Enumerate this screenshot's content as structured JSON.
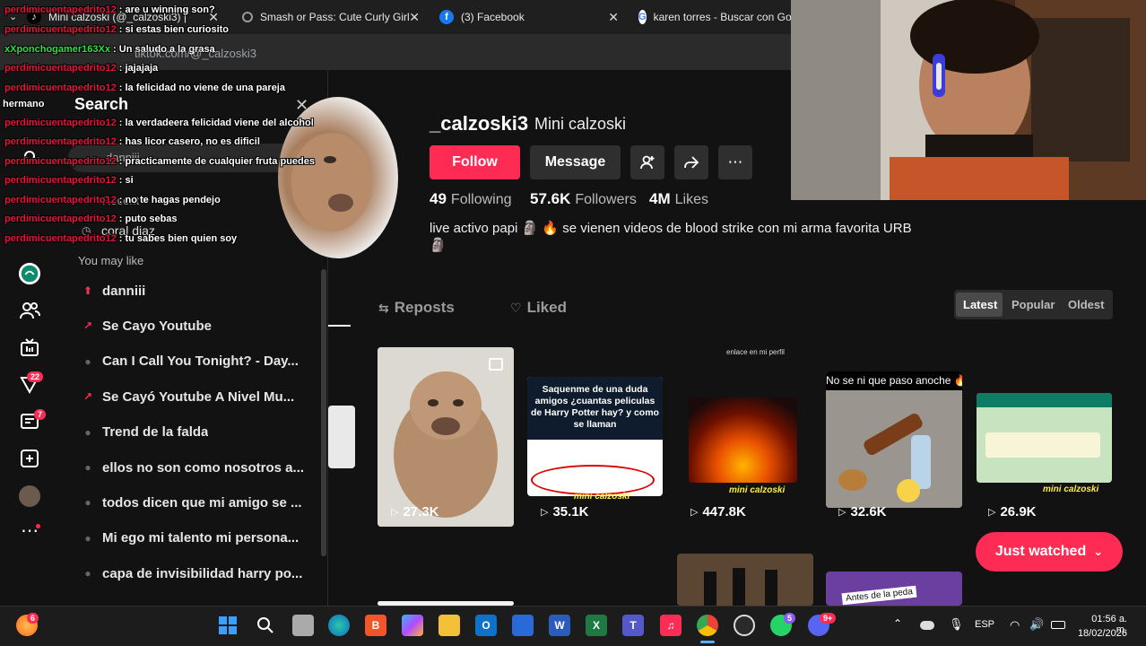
{
  "browser": {
    "tabs": [
      {
        "title": "Mini calzoski (@_calzoski3) | "
      },
      {
        "title": "Smash or Pass: Cute Curly Girl -"
      },
      {
        "title": "(3) Facebook"
      },
      {
        "title": "karen torres - Buscar con Goo"
      }
    ],
    "url": "tiktok.com/@_calzoski3"
  },
  "search_panel": {
    "title": "Search",
    "query": "danniii",
    "recent_label": "Recent",
    "recent_item": "coral diaz",
    "you_may_like": "You may like",
    "suggestions": [
      {
        "label": "danniii",
        "icon": "arrow-up-icon"
      },
      {
        "label": "Se Cayo Youtube",
        "icon": "trending-icon"
      },
      {
        "label": "Can I Call You Tonight? - Day...",
        "icon": "dot-icon"
      },
      {
        "label": "Se Cayó Youtube A Nivel Mu...",
        "icon": "trending-icon"
      },
      {
        "label": "Trend de la falda",
        "icon": "dot-icon"
      },
      {
        "label": "ellos no son como nosotros a...",
        "icon": "dot-icon"
      },
      {
        "label": "todos dicen que mi amigo se ...",
        "icon": "dot-icon"
      },
      {
        "label": "Mi ego mi talento mi persona...",
        "icon": "dot-icon"
      },
      {
        "label": "capa de invisibilidad harry po...",
        "icon": "dot-icon"
      }
    ]
  },
  "left_nav": {
    "inbox_badge": "22",
    "messages_badge": "7"
  },
  "profile": {
    "username": "_calzoski3",
    "nickname": "Mini calzoski",
    "follow_label": "Follow",
    "message_label": "Message",
    "following_count": "49",
    "following_label": "Following",
    "followers_count": "57.6K",
    "followers_label": "Followers",
    "likes_count": "4M",
    "likes_label": "Likes",
    "bio_line1": "live activo papi 🗿 🔥 se vienen videos de blood strike con mi arma favorita URB",
    "bio_line2": "🗿"
  },
  "tabs": {
    "reposts": "Reposts",
    "liked": "Liked",
    "sort_latest": "Latest",
    "sort_popular": "Popular",
    "sort_oldest": "Oldest"
  },
  "videos": [
    {
      "views": "27.3K"
    },
    {
      "views": "35.1K",
      "title": "Saquenme de una duda amigos ¿cuantas peliculas de Harry Potter hay? y como se llaman",
      "watermark": "mini calzoski"
    },
    {
      "views": "447.8K",
      "watermark": "mini calzoski",
      "caption": "enlace en mi perfil"
    },
    {
      "views": "32.6K",
      "title": "No se ni que paso anoche 🔥"
    },
    {
      "views": "26.9K",
      "watermark": "mini calzoski"
    }
  ],
  "next_row": {
    "caption": "Antes de la peda"
  },
  "just_watched": "Just watched",
  "chat": [
    {
      "user": "perdimicuentapedrito12",
      "msg": " : are u winning son?"
    },
    {
      "user": "perdimicuentapedrito12",
      "msg": " : si estas bien curiosito"
    },
    {
      "user": "xXponchogamer163Xx",
      "msg": " : Un saludo a la grasa",
      "green": true
    },
    {
      "user": "perdimicuentapedrito12",
      "msg": " : jajajaja"
    },
    {
      "user": "perdimicuentapedrito12",
      "msg": " : la felicidad no viene de una pareja"
    },
    {
      "user": "",
      "msg": "hermano"
    },
    {
      "user": "perdimicuentapedrito12",
      "msg": " : la verdadeera felicidad viene del alcohol"
    },
    {
      "user": "perdimicuentapedrito12",
      "msg": " : has licor casero, no es dificil"
    },
    {
      "user": "perdimicuentapedrito12",
      "msg": " : practicamente de cualquier fruta puedes"
    },
    {
      "user": "perdimicuentapedrito12",
      "msg": " : si"
    },
    {
      "user": "perdimicuentapedrito12",
      "msg": " : no te hagas pendejo"
    },
    {
      "user": "perdimicuentapedrito12",
      "msg": " : puto sebas"
    },
    {
      "user": "perdimicuentapedrito12",
      "msg": " : tu sabes bien quien soy"
    }
  ],
  "taskbar": {
    "firefox_badge": "6",
    "discord_badge": "9+",
    "whatsapp_badge": "5",
    "lang": "ESP",
    "time": "01:56 a. m.",
    "date": "18/02/2026"
  },
  "colors": {
    "accent": "#fe2c55",
    "background": "#121212",
    "chat_user": "#e8113a",
    "chat_user_alt": "#25e33e"
  }
}
